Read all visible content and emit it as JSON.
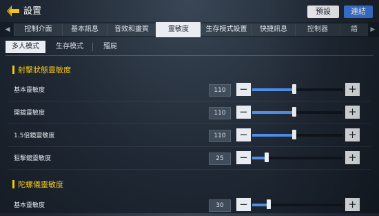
{
  "header": {
    "title": "設置",
    "preset_label": "預設",
    "connect_label": "連結"
  },
  "tabs": [
    {
      "label": "控制介面",
      "active": false
    },
    {
      "label": "基本訊息",
      "active": false
    },
    {
      "label": "音效和畫質",
      "active": false
    },
    {
      "label": "靈敏度",
      "active": true
    },
    {
      "label": "生存模式設置",
      "active": false
    },
    {
      "label": "快捷訊息",
      "active": false
    },
    {
      "label": "控制器",
      "active": false
    },
    {
      "label": "語",
      "active": false
    }
  ],
  "subtabs": [
    {
      "label": "多人模式",
      "active": true
    },
    {
      "label": "生存模式",
      "active": false
    },
    {
      "label": "殭屍",
      "active": false
    }
  ],
  "sections": [
    {
      "title": "射擊狀態靈敏度",
      "rows": [
        {
          "label": "基本靈敏度",
          "value": "110",
          "fraction": 0.46
        },
        {
          "label": "開鏡靈敏度",
          "value": "110",
          "fraction": 0.46
        },
        {
          "label": "1.5倍鏡靈敏度",
          "value": "110",
          "fraction": 0.46
        },
        {
          "label": "狙擊鏡靈敏度",
          "value": "25",
          "fraction": 0.16
        }
      ]
    },
    {
      "title": "陀螺儀靈敏度",
      "rows": [
        {
          "label": "基本靈敏度",
          "value": "30",
          "fraction": 0.18
        }
      ]
    }
  ],
  "colors": {
    "accent": "#f2c418",
    "slider_fill": "#4f8fe6",
    "connect": "#3e7be0"
  },
  "icons": {
    "back": "back-arrow-icon",
    "minus": "minus-icon",
    "plus": "plus-icon",
    "tab_left": "chevron-left-icon",
    "tab_right": "chevron-right-icon"
  }
}
